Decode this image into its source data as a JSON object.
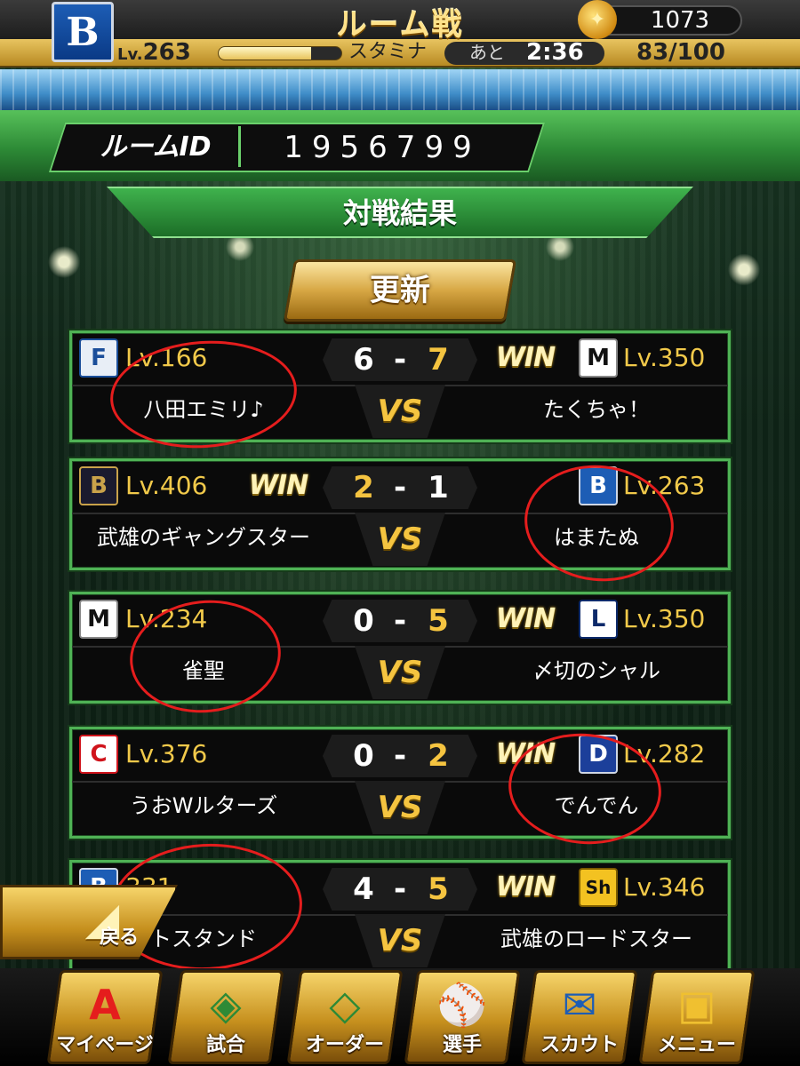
{
  "header": {
    "title": "ルーム戦",
    "coins": "1073",
    "level_prefix": "Lv.",
    "level_value": "263",
    "stamina_label": "スタミナ",
    "stamina_timer_label": "あと",
    "stamina_timer_value": "2:36",
    "stamina_count": "83/100",
    "exp_progress": 0.75,
    "team_logo_letter": "B"
  },
  "room": {
    "id_label": "ルームID",
    "id_value": "1956799"
  },
  "results": {
    "title": "対戦結果",
    "refresh_label": "更新",
    "win_text": "WIN",
    "vs_text": "VS",
    "matches": [
      {
        "left": {
          "logo": "F",
          "logo_icon": "fighters-logo",
          "level": "Lv.166",
          "name": "八田エミリ♪",
          "score": "6"
        },
        "right": {
          "logo": "M",
          "logo_icon": "marines-logo",
          "level": "Lv.350",
          "name": "たくちゃ！",
          "score": "7"
        },
        "winner": "right"
      },
      {
        "left": {
          "logo": "B",
          "logo_icon": "buffaloes-logo",
          "level": "Lv.406",
          "name": "武雄のギャングスター",
          "score": "2"
        },
        "right": {
          "logo": "B",
          "logo_icon": "baystars-logo",
          "level": "Lv.263",
          "name": "はまたぬ",
          "score": "1"
        },
        "winner": "left"
      },
      {
        "left": {
          "logo": "M",
          "logo_icon": "marines-logo",
          "level": "Lv.234",
          "name": "雀聖",
          "score": "0"
        },
        "right": {
          "logo": "L",
          "logo_icon": "lions-logo",
          "level": "Lv.350",
          "name": "〆切のシャル",
          "score": "5"
        },
        "winner": "right"
      },
      {
        "left": {
          "logo": "C",
          "logo_icon": "carp-logo",
          "level": "Lv.376",
          "name": "うおWルターズ",
          "score": "0"
        },
        "right": {
          "logo": "D",
          "logo_icon": "dragons-logo",
          "level": "Lv.282",
          "name": "でんでん",
          "score": "2"
        },
        "winner": "right"
      },
      {
        "left": {
          "logo": "B",
          "logo_icon": "baystars-logo",
          "level": "331",
          "name": "トスタンド",
          "score": "4"
        },
        "right": {
          "logo": "Sh",
          "logo_icon": "hawks-logo",
          "level": "Lv.346",
          "name": "武雄のロードスター",
          "score": "5"
        },
        "winner": "right"
      }
    ]
  },
  "back_button": {
    "label": "戻る"
  },
  "bottom_nav": [
    {
      "label": "マイページ",
      "icon": "mypage-icon"
    },
    {
      "label": "試合",
      "icon": "stadium-icon"
    },
    {
      "label": "オーダー",
      "icon": "order-icon"
    },
    {
      "label": "選手",
      "icon": "player-icon"
    },
    {
      "label": "スカウト",
      "icon": "scout-icon"
    },
    {
      "label": "メニュー",
      "icon": "menu-icon"
    }
  ],
  "colors": {
    "gold": "#f5c440",
    "green_border": "#4fb255",
    "annotation_red": "#e51d1d"
  }
}
